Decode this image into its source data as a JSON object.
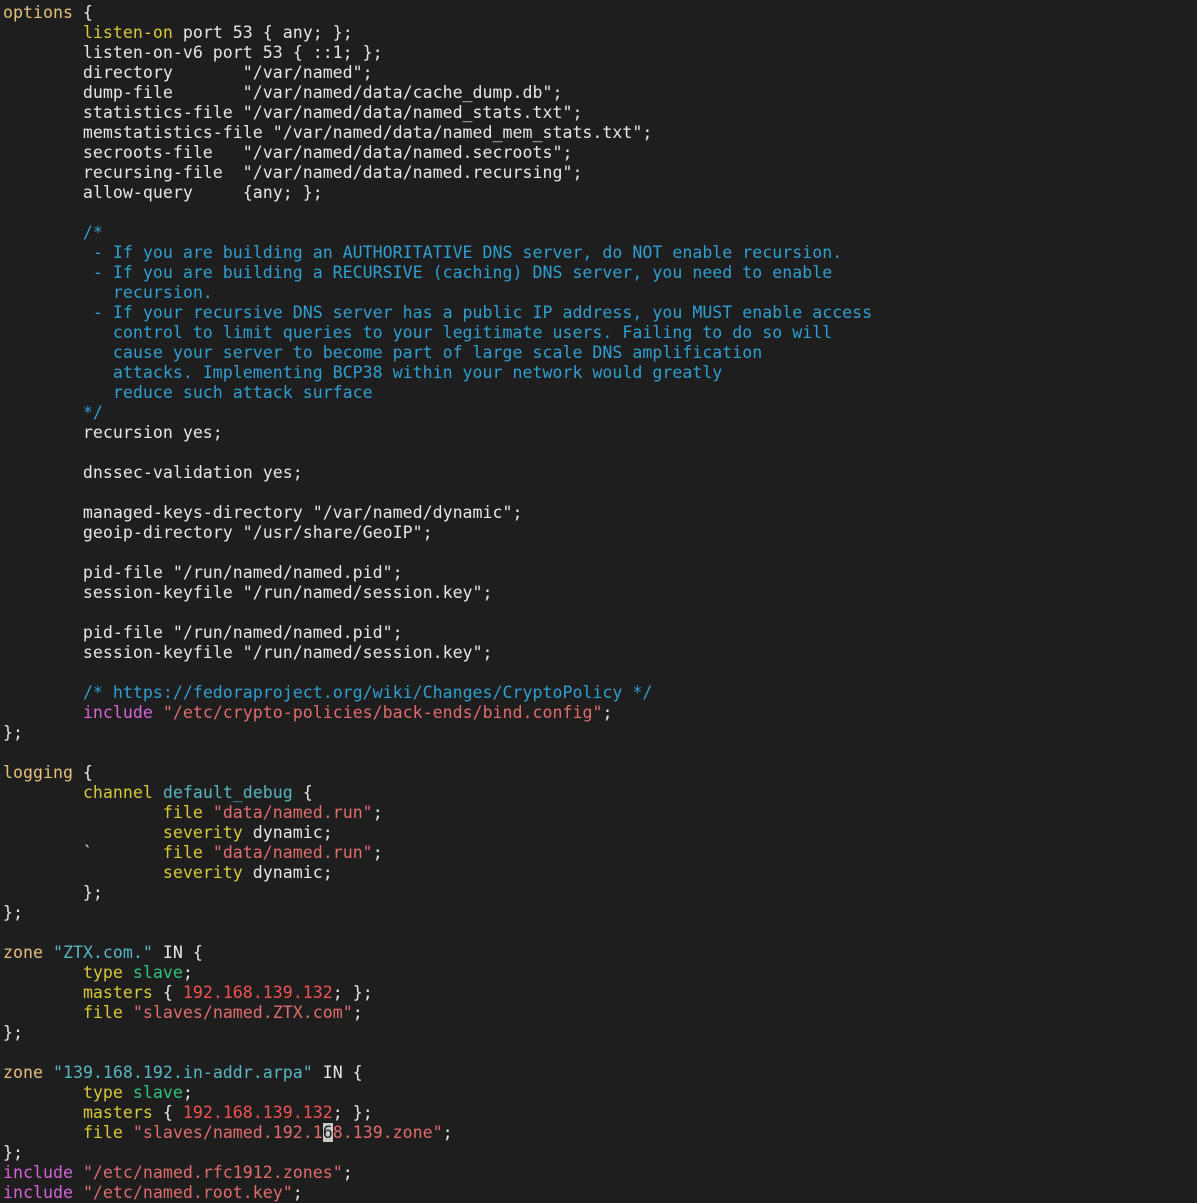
{
  "palette": {
    "plain": "#e6e6e6",
    "keyword": "#e5c07b",
    "comment": "#2f9fd0",
    "string": "#e06c6c",
    "yellow": "#d7c83a",
    "cyan": "#56b6c2",
    "green": "#2ec27e",
    "magenta": "#d663d6",
    "number": "#ef5350"
  },
  "cursor_line": 56,
  "lines": [
    [
      {
        "t": "options",
        "c": "keyword"
      },
      {
        "t": " {",
        "c": "plain"
      }
    ],
    [
      {
        "t": "        ",
        "c": "plain"
      },
      {
        "t": "listen-on",
        "c": "yellow"
      },
      {
        "t": " port 53 { any; };",
        "c": "plain"
      }
    ],
    [
      {
        "t": "        listen-on-v6 port 53 { ::1; };",
        "c": "plain"
      }
    ],
    [
      {
        "t": "        directory       \"/var/named\";",
        "c": "plain"
      }
    ],
    [
      {
        "t": "        dump-file       \"/var/named/data/cache_dump.db\";",
        "c": "plain"
      }
    ],
    [
      {
        "t": "        statistics-file \"/var/named/data/named_stats.txt\";",
        "c": "plain"
      }
    ],
    [
      {
        "t": "        memstatistics-file \"/var/named/data/named_mem_stats.txt\";",
        "c": "plain"
      }
    ],
    [
      {
        "t": "        secroots-file   \"/var/named/data/named.secroots\";",
        "c": "plain"
      }
    ],
    [
      {
        "t": "        recursing-file  \"/var/named/data/named.recursing\";",
        "c": "plain"
      }
    ],
    [
      {
        "t": "        allow-query     {any; };",
        "c": "plain"
      }
    ],
    [
      {
        "t": "",
        "c": "plain"
      }
    ],
    [
      {
        "t": "        /*",
        "c": "comment"
      }
    ],
    [
      {
        "t": "         - If you are building an AUTHORITATIVE DNS server, do NOT enable recursion.",
        "c": "comment"
      }
    ],
    [
      {
        "t": "         - If you are building a RECURSIVE (caching) DNS server, you need to enable",
        "c": "comment"
      }
    ],
    [
      {
        "t": "           recursion.",
        "c": "comment"
      }
    ],
    [
      {
        "t": "         - If your recursive DNS server has a public IP address, you MUST enable access",
        "c": "comment"
      }
    ],
    [
      {
        "t": "           control to limit queries to your legitimate users. Failing to do so will",
        "c": "comment"
      }
    ],
    [
      {
        "t": "           cause your server to become part of large scale DNS amplification",
        "c": "comment"
      }
    ],
    [
      {
        "t": "           attacks. Implementing BCP38 within your network would greatly",
        "c": "comment"
      }
    ],
    [
      {
        "t": "           reduce such attack surface",
        "c": "comment"
      }
    ],
    [
      {
        "t": "        */",
        "c": "comment"
      }
    ],
    [
      {
        "t": "        recursion yes;",
        "c": "plain"
      }
    ],
    [
      {
        "t": "",
        "c": "plain"
      }
    ],
    [
      {
        "t": "        dnssec-validation yes;",
        "c": "plain"
      }
    ],
    [
      {
        "t": "",
        "c": "plain"
      }
    ],
    [
      {
        "t": "        managed-keys-directory \"/var/named/dynamic\";",
        "c": "plain"
      }
    ],
    [
      {
        "t": "        geoip-directory \"/usr/share/GeoIP\";",
        "c": "plain"
      }
    ],
    [
      {
        "t": "",
        "c": "plain"
      }
    ],
    [
      {
        "t": "        pid-file \"/run/named/named.pid\";",
        "c": "plain"
      }
    ],
    [
      {
        "t": "        session-keyfile \"/run/named/session.key\";",
        "c": "plain"
      }
    ],
    [
      {
        "t": "",
        "c": "plain"
      }
    ],
    [
      {
        "t": "        pid-file \"/run/named/named.pid\";",
        "c": "plain"
      }
    ],
    [
      {
        "t": "        session-keyfile \"/run/named/session.key\";",
        "c": "plain"
      }
    ],
    [
      {
        "t": "",
        "c": "plain"
      }
    ],
    [
      {
        "t": "        ",
        "c": "plain"
      },
      {
        "t": "/* https://fedoraproject.org/wiki/Changes/CryptoPolicy */",
        "c": "comment"
      }
    ],
    [
      {
        "t": "        ",
        "c": "plain"
      },
      {
        "t": "include",
        "c": "magenta"
      },
      {
        "t": " ",
        "c": "plain"
      },
      {
        "t": "\"/etc/crypto-policies/back-ends/bind.config\"",
        "c": "string"
      },
      {
        "t": ";",
        "c": "plain"
      }
    ],
    [
      {
        "t": "};",
        "c": "plain"
      }
    ],
    [
      {
        "t": "",
        "c": "plain"
      }
    ],
    [
      {
        "t": "logging",
        "c": "keyword"
      },
      {
        "t": " {",
        "c": "plain"
      }
    ],
    [
      {
        "t": "        ",
        "c": "plain"
      },
      {
        "t": "channel",
        "c": "yellow"
      },
      {
        "t": " ",
        "c": "plain"
      },
      {
        "t": "default_debug",
        "c": "cyan"
      },
      {
        "t": " {",
        "c": "plain"
      }
    ],
    [
      {
        "t": "                ",
        "c": "plain"
      },
      {
        "t": "file",
        "c": "yellow"
      },
      {
        "t": " ",
        "c": "plain"
      },
      {
        "t": "\"data/named.run\"",
        "c": "string"
      },
      {
        "t": ";",
        "c": "plain"
      }
    ],
    [
      {
        "t": "                ",
        "c": "plain"
      },
      {
        "t": "severity",
        "c": "yellow"
      },
      {
        "t": " dynamic;",
        "c": "plain"
      }
    ],
    [
      {
        "t": "        `       ",
        "c": "plain"
      },
      {
        "t": "file",
        "c": "yellow"
      },
      {
        "t": " ",
        "c": "plain"
      },
      {
        "t": "\"data/named.run\"",
        "c": "string"
      },
      {
        "t": ";",
        "c": "plain"
      }
    ],
    [
      {
        "t": "                ",
        "c": "plain"
      },
      {
        "t": "severity",
        "c": "yellow"
      },
      {
        "t": " dynamic;",
        "c": "plain"
      }
    ],
    [
      {
        "t": "        };",
        "c": "plain"
      }
    ],
    [
      {
        "t": "};",
        "c": "plain"
      }
    ],
    [
      {
        "t": "",
        "c": "plain"
      }
    ],
    [
      {
        "t": "zone",
        "c": "keyword"
      },
      {
        "t": " ",
        "c": "plain"
      },
      {
        "t": "\"ZTX.com.\"",
        "c": "cyan"
      },
      {
        "t": " IN {",
        "c": "plain"
      }
    ],
    [
      {
        "t": "        ",
        "c": "plain"
      },
      {
        "t": "type",
        "c": "yellow"
      },
      {
        "t": " ",
        "c": "plain"
      },
      {
        "t": "slave",
        "c": "green"
      },
      {
        "t": ";",
        "c": "plain"
      }
    ],
    [
      {
        "t": "        ",
        "c": "plain"
      },
      {
        "t": "masters",
        "c": "yellow"
      },
      {
        "t": " { ",
        "c": "plain"
      },
      {
        "t": "192.168.139.132",
        "c": "number"
      },
      {
        "t": "; };",
        "c": "plain"
      }
    ],
    [
      {
        "t": "        ",
        "c": "plain"
      },
      {
        "t": "file",
        "c": "yellow"
      },
      {
        "t": " ",
        "c": "plain"
      },
      {
        "t": "\"slaves/named.ZTX.com\"",
        "c": "string"
      },
      {
        "t": ";",
        "c": "plain"
      }
    ],
    [
      {
        "t": "};",
        "c": "plain"
      }
    ],
    [
      {
        "t": "",
        "c": "plain"
      }
    ],
    [
      {
        "t": "zone",
        "c": "keyword"
      },
      {
        "t": " ",
        "c": "plain"
      },
      {
        "t": "\"139.168.192.in-addr.arpa\"",
        "c": "cyan"
      },
      {
        "t": " IN {",
        "c": "plain"
      }
    ],
    [
      {
        "t": "        ",
        "c": "plain"
      },
      {
        "t": "type",
        "c": "yellow"
      },
      {
        "t": " ",
        "c": "plain"
      },
      {
        "t": "slave",
        "c": "green"
      },
      {
        "t": ";",
        "c": "plain"
      }
    ],
    [
      {
        "t": "        ",
        "c": "plain"
      },
      {
        "t": "masters",
        "c": "yellow"
      },
      {
        "t": " { ",
        "c": "plain"
      },
      {
        "t": "192.168.139.132",
        "c": "number"
      },
      {
        "t": "; };",
        "c": "plain"
      }
    ],
    [
      {
        "t": "        ",
        "c": "plain"
      },
      {
        "t": "file",
        "c": "yellow"
      },
      {
        "t": " ",
        "c": "plain"
      },
      {
        "t": "\"slaves/named.192.1",
        "c": "string"
      },
      {
        "t": "6",
        "c": "cursor"
      },
      {
        "t": "8.139.zone\"",
        "c": "string"
      },
      {
        "t": ";",
        "c": "plain"
      }
    ],
    [
      {
        "t": "};",
        "c": "plain"
      }
    ],
    [
      {
        "t": "include",
        "c": "magenta"
      },
      {
        "t": " ",
        "c": "plain"
      },
      {
        "t": "\"/etc/named.rfc1912.zones\"",
        "c": "string"
      },
      {
        "t": ";",
        "c": "plain"
      }
    ],
    [
      {
        "t": "include",
        "c": "magenta"
      },
      {
        "t": " ",
        "c": "plain"
      },
      {
        "t": "\"/etc/named.root.key\"",
        "c": "string"
      },
      {
        "t": ";",
        "c": "plain"
      }
    ]
  ]
}
